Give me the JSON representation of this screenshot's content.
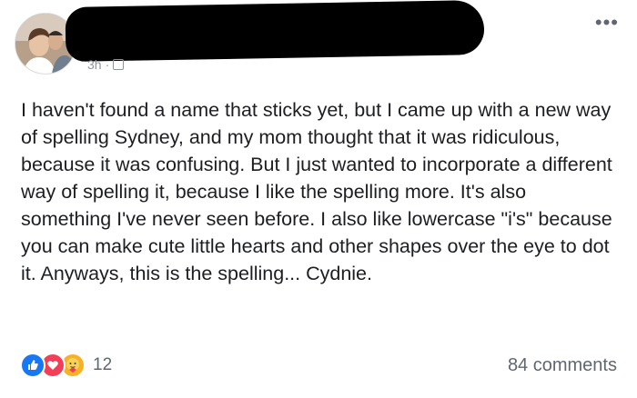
{
  "post": {
    "timestamp": "3h",
    "body": "I haven't found a name that sticks yet, but I came up with a new way of spelling Sydney, and my mom thought that it was ridiculous, because it was confusing. But I just wanted to incorporate a different way of spelling it, because I like the spelling more. It's also something I've never seen before. I also like lowercase \"i's\" because you can make cute little hearts and other shapes over the eye to dot it. Anyways, this is the spelling... Cydnie.",
    "more_label": "•••"
  },
  "footer": {
    "reaction_count": "12",
    "comments_label": "84 comments"
  },
  "icons": [
    "avatar",
    "friends-icon",
    "more-options-icon",
    "like-reaction-icon",
    "love-reaction-icon",
    "care-reaction-icon"
  ],
  "colors": {
    "like": "#1877f2",
    "love": "#f33e58",
    "care": "#f7b125",
    "secondary_text": "#606770"
  }
}
